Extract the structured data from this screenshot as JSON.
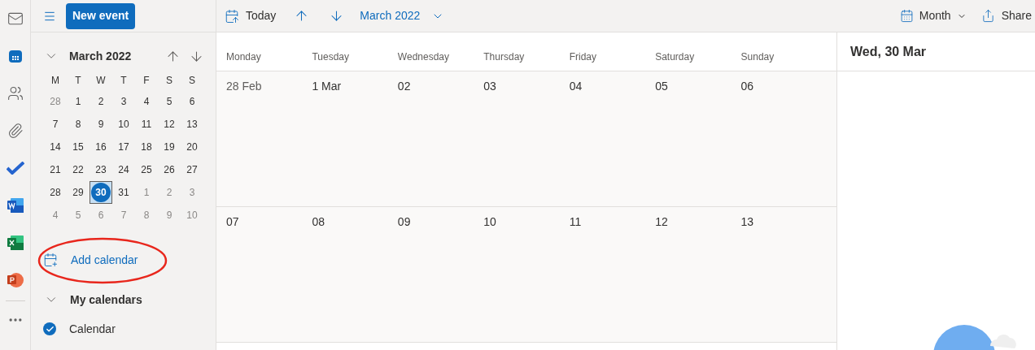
{
  "toolbar": {
    "new_event": "New event",
    "today": "Today",
    "month_label": "March 2022",
    "view": "Month",
    "share": "Share"
  },
  "app_rail": [
    {
      "kind": "mail",
      "selected": false
    },
    {
      "kind": "calendar",
      "selected": true
    },
    {
      "kind": "people",
      "selected": false
    },
    {
      "kind": "files",
      "selected": false
    },
    {
      "kind": "todo",
      "selected": false
    },
    {
      "kind": "word",
      "selected": false
    },
    {
      "kind": "excel",
      "selected": false
    },
    {
      "kind": "powerpoint",
      "selected": false
    },
    {
      "kind": "more",
      "selected": false
    }
  ],
  "mini_calendar": {
    "title": "March 2022",
    "weekdays": [
      "M",
      "T",
      "W",
      "T",
      "F",
      "S",
      "S"
    ],
    "weeks": [
      [
        {
          "day": "28",
          "muted": true,
          "selected": false
        },
        {
          "day": "1",
          "muted": false,
          "selected": false
        },
        {
          "day": "2",
          "muted": false,
          "selected": false
        },
        {
          "day": "3",
          "muted": false,
          "selected": false
        },
        {
          "day": "4",
          "muted": false,
          "selected": false
        },
        {
          "day": "5",
          "muted": false,
          "selected": false
        },
        {
          "day": "6",
          "muted": false,
          "selected": false
        }
      ],
      [
        {
          "day": "7",
          "muted": false,
          "selected": false
        },
        {
          "day": "8",
          "muted": false,
          "selected": false
        },
        {
          "day": "9",
          "muted": false,
          "selected": false
        },
        {
          "day": "10",
          "muted": false,
          "selected": false
        },
        {
          "day": "11",
          "muted": false,
          "selected": false
        },
        {
          "day": "12",
          "muted": false,
          "selected": false
        },
        {
          "day": "13",
          "muted": false,
          "selected": false
        }
      ],
      [
        {
          "day": "14",
          "muted": false,
          "selected": false
        },
        {
          "day": "15",
          "muted": false,
          "selected": false
        },
        {
          "day": "16",
          "muted": false,
          "selected": false
        },
        {
          "day": "17",
          "muted": false,
          "selected": false
        },
        {
          "day": "18",
          "muted": false,
          "selected": false
        },
        {
          "day": "19",
          "muted": false,
          "selected": false
        },
        {
          "day": "20",
          "muted": false,
          "selected": false
        }
      ],
      [
        {
          "day": "21",
          "muted": false,
          "selected": false
        },
        {
          "day": "22",
          "muted": false,
          "selected": false
        },
        {
          "day": "23",
          "muted": false,
          "selected": false
        },
        {
          "day": "24",
          "muted": false,
          "selected": false
        },
        {
          "day": "25",
          "muted": false,
          "selected": false
        },
        {
          "day": "26",
          "muted": false,
          "selected": false
        },
        {
          "day": "27",
          "muted": false,
          "selected": false
        }
      ],
      [
        {
          "day": "28",
          "muted": false,
          "selected": false
        },
        {
          "day": "29",
          "muted": false,
          "selected": false
        },
        {
          "day": "30",
          "muted": false,
          "selected": true
        },
        {
          "day": "31",
          "muted": false,
          "selected": false
        },
        {
          "day": "1",
          "muted": true,
          "selected": false
        },
        {
          "day": "2",
          "muted": true,
          "selected": false
        },
        {
          "day": "3",
          "muted": true,
          "selected": false
        }
      ],
      [
        {
          "day": "4",
          "muted": true,
          "selected": false
        },
        {
          "day": "5",
          "muted": true,
          "selected": false
        },
        {
          "day": "6",
          "muted": true,
          "selected": false
        },
        {
          "day": "7",
          "muted": true,
          "selected": false
        },
        {
          "day": "8",
          "muted": true,
          "selected": false
        },
        {
          "day": "9",
          "muted": true,
          "selected": false
        },
        {
          "day": "10",
          "muted": true,
          "selected": false
        }
      ]
    ]
  },
  "add_calendar": {
    "label": "Add calendar",
    "circled": true
  },
  "my_calendars": {
    "title": "My calendars",
    "expanded": true,
    "items": [
      {
        "name": "Calendar",
        "checked": true
      }
    ]
  },
  "month_grid": {
    "weekdays": [
      "Monday",
      "Tuesday",
      "Wednesday",
      "Thursday",
      "Friday",
      "Saturday",
      "Sunday"
    ],
    "weeks": [
      [
        "28 Feb",
        "1 Mar",
        "02",
        "03",
        "04",
        "05",
        "06"
      ],
      [
        "07",
        "08",
        "09",
        "10",
        "11",
        "12",
        "13"
      ]
    ]
  },
  "day_pane": {
    "title": "Wed, 30 Mar"
  }
}
